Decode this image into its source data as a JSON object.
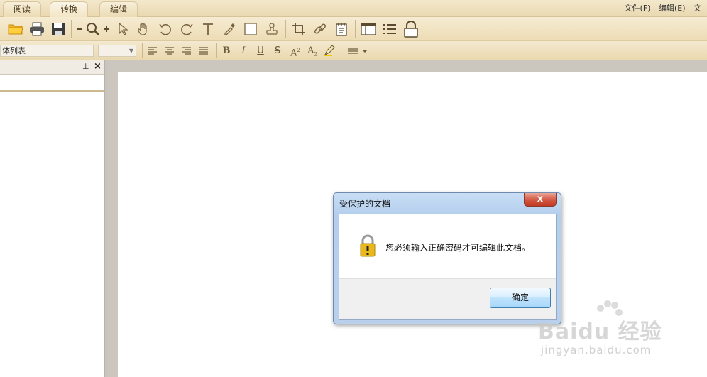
{
  "tabs": [
    {
      "label": "阅读"
    },
    {
      "label": "转换"
    },
    {
      "label": "编辑"
    }
  ],
  "menu": {
    "file": "文件(F)",
    "edit": "编辑(E)",
    "more": "文"
  },
  "toolbar": {
    "icons": [
      "folder-open-icon",
      "print-icon",
      "save-icon",
      "zoom-out-icon",
      "zoom-icon",
      "zoom-in-icon",
      "select-arrow-icon",
      "hand-icon",
      "rotate-left-icon",
      "rotate-right-icon",
      "text-tool-icon",
      "eyedropper-icon",
      "rectangle-icon",
      "stamp-icon",
      "crop-icon",
      "link-icon",
      "note-icon",
      "layout-icon",
      "list-icon",
      "lock-icon"
    ]
  },
  "format_bar": {
    "font_name": "体列表",
    "font_size": "",
    "bold": "B",
    "italic": "I",
    "underline": "U",
    "strikethrough": "S",
    "superscript": "A",
    "subscript": "A"
  },
  "dialog": {
    "title": "受保护的文档",
    "close_label": "x",
    "message": "您必须输入正确密码才可编辑此文档。",
    "ok_label": "确定"
  },
  "watermark": {
    "brand": "Baidu 经验",
    "url": "jingyan.baidu.com"
  },
  "colors": {
    "toolbar_bg": "#eddcb4",
    "icon_brown": "#7a6340",
    "dialog_frame": "#b8d0ec",
    "ok_button": "#bfe3fc",
    "close_button": "#d35a45"
  }
}
